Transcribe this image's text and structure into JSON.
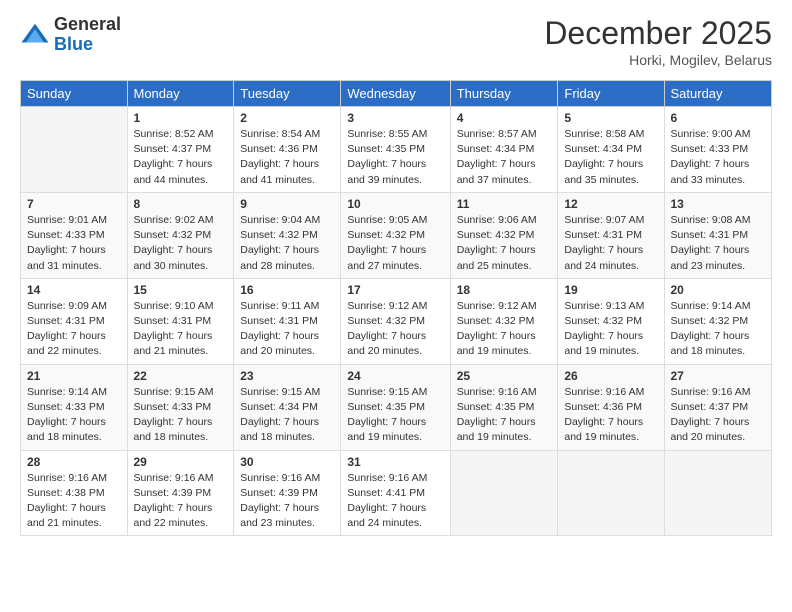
{
  "header": {
    "logo_general": "General",
    "logo_blue": "Blue",
    "month": "December 2025",
    "location": "Horki, Mogilev, Belarus"
  },
  "days_of_week": [
    "Sunday",
    "Monday",
    "Tuesday",
    "Wednesday",
    "Thursday",
    "Friday",
    "Saturday"
  ],
  "weeks": [
    [
      {
        "day": "",
        "text": ""
      },
      {
        "day": "1",
        "text": "Sunrise: 8:52 AM\nSunset: 4:37 PM\nDaylight: 7 hours\nand 44 minutes."
      },
      {
        "day": "2",
        "text": "Sunrise: 8:54 AM\nSunset: 4:36 PM\nDaylight: 7 hours\nand 41 minutes."
      },
      {
        "day": "3",
        "text": "Sunrise: 8:55 AM\nSunset: 4:35 PM\nDaylight: 7 hours\nand 39 minutes."
      },
      {
        "day": "4",
        "text": "Sunrise: 8:57 AM\nSunset: 4:34 PM\nDaylight: 7 hours\nand 37 minutes."
      },
      {
        "day": "5",
        "text": "Sunrise: 8:58 AM\nSunset: 4:34 PM\nDaylight: 7 hours\nand 35 minutes."
      },
      {
        "day": "6",
        "text": "Sunrise: 9:00 AM\nSunset: 4:33 PM\nDaylight: 7 hours\nand 33 minutes."
      }
    ],
    [
      {
        "day": "7",
        "text": "Sunrise: 9:01 AM\nSunset: 4:33 PM\nDaylight: 7 hours\nand 31 minutes."
      },
      {
        "day": "8",
        "text": "Sunrise: 9:02 AM\nSunset: 4:32 PM\nDaylight: 7 hours\nand 30 minutes."
      },
      {
        "day": "9",
        "text": "Sunrise: 9:04 AM\nSunset: 4:32 PM\nDaylight: 7 hours\nand 28 minutes."
      },
      {
        "day": "10",
        "text": "Sunrise: 9:05 AM\nSunset: 4:32 PM\nDaylight: 7 hours\nand 27 minutes."
      },
      {
        "day": "11",
        "text": "Sunrise: 9:06 AM\nSunset: 4:32 PM\nDaylight: 7 hours\nand 25 minutes."
      },
      {
        "day": "12",
        "text": "Sunrise: 9:07 AM\nSunset: 4:31 PM\nDaylight: 7 hours\nand 24 minutes."
      },
      {
        "day": "13",
        "text": "Sunrise: 9:08 AM\nSunset: 4:31 PM\nDaylight: 7 hours\nand 23 minutes."
      }
    ],
    [
      {
        "day": "14",
        "text": "Sunrise: 9:09 AM\nSunset: 4:31 PM\nDaylight: 7 hours\nand 22 minutes."
      },
      {
        "day": "15",
        "text": "Sunrise: 9:10 AM\nSunset: 4:31 PM\nDaylight: 7 hours\nand 21 minutes."
      },
      {
        "day": "16",
        "text": "Sunrise: 9:11 AM\nSunset: 4:31 PM\nDaylight: 7 hours\nand 20 minutes."
      },
      {
        "day": "17",
        "text": "Sunrise: 9:12 AM\nSunset: 4:32 PM\nDaylight: 7 hours\nand 20 minutes."
      },
      {
        "day": "18",
        "text": "Sunrise: 9:12 AM\nSunset: 4:32 PM\nDaylight: 7 hours\nand 19 minutes."
      },
      {
        "day": "19",
        "text": "Sunrise: 9:13 AM\nSunset: 4:32 PM\nDaylight: 7 hours\nand 19 minutes."
      },
      {
        "day": "20",
        "text": "Sunrise: 9:14 AM\nSunset: 4:32 PM\nDaylight: 7 hours\nand 18 minutes."
      }
    ],
    [
      {
        "day": "21",
        "text": "Sunrise: 9:14 AM\nSunset: 4:33 PM\nDaylight: 7 hours\nand 18 minutes."
      },
      {
        "day": "22",
        "text": "Sunrise: 9:15 AM\nSunset: 4:33 PM\nDaylight: 7 hours\nand 18 minutes."
      },
      {
        "day": "23",
        "text": "Sunrise: 9:15 AM\nSunset: 4:34 PM\nDaylight: 7 hours\nand 18 minutes."
      },
      {
        "day": "24",
        "text": "Sunrise: 9:15 AM\nSunset: 4:35 PM\nDaylight: 7 hours\nand 19 minutes."
      },
      {
        "day": "25",
        "text": "Sunrise: 9:16 AM\nSunset: 4:35 PM\nDaylight: 7 hours\nand 19 minutes."
      },
      {
        "day": "26",
        "text": "Sunrise: 9:16 AM\nSunset: 4:36 PM\nDaylight: 7 hours\nand 19 minutes."
      },
      {
        "day": "27",
        "text": "Sunrise: 9:16 AM\nSunset: 4:37 PM\nDaylight: 7 hours\nand 20 minutes."
      }
    ],
    [
      {
        "day": "28",
        "text": "Sunrise: 9:16 AM\nSunset: 4:38 PM\nDaylight: 7 hours\nand 21 minutes."
      },
      {
        "day": "29",
        "text": "Sunrise: 9:16 AM\nSunset: 4:39 PM\nDaylight: 7 hours\nand 22 minutes."
      },
      {
        "day": "30",
        "text": "Sunrise: 9:16 AM\nSunset: 4:39 PM\nDaylight: 7 hours\nand 23 minutes."
      },
      {
        "day": "31",
        "text": "Sunrise: 9:16 AM\nSunset: 4:41 PM\nDaylight: 7 hours\nand 24 minutes."
      },
      {
        "day": "",
        "text": ""
      },
      {
        "day": "",
        "text": ""
      },
      {
        "day": "",
        "text": ""
      }
    ]
  ]
}
